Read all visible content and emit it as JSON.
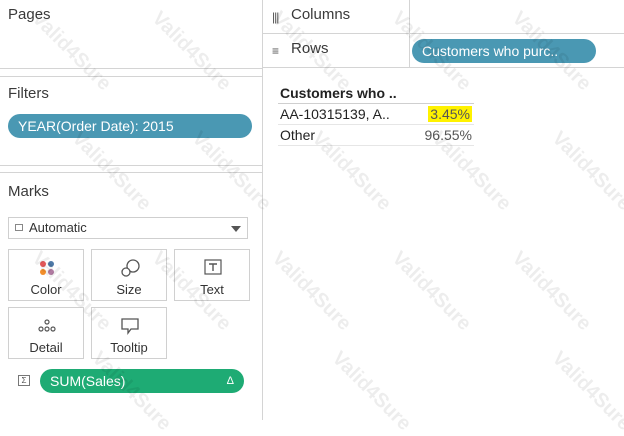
{
  "pages": {
    "title": "Pages"
  },
  "filters": {
    "title": "Filters",
    "items": [
      "YEAR(Order Date): 2015"
    ]
  },
  "marks": {
    "title": "Marks",
    "mark_type": "Automatic",
    "buttons": [
      "Color",
      "Size",
      "Text",
      "Detail",
      "Tooltip"
    ],
    "measure_pill": "SUM(Sales)",
    "measure_pill_badge": "Δ"
  },
  "shelves": {
    "columns_label": "Columns",
    "rows_label": "Rows",
    "rows_pill": "Customers who purc.."
  },
  "table": {
    "header": "Customers who ..",
    "rows": [
      {
        "name": "AA-10315139, A..",
        "value": "3.45%",
        "highlighted": true
      },
      {
        "name": "Other",
        "value": "96.55%",
        "highlighted": false
      }
    ]
  },
  "watermark": "Valid4Sure",
  "colors": {
    "dimension_pill": "#4a98b3",
    "measure_pill": "#1eab74",
    "highlight": "#fff200"
  }
}
